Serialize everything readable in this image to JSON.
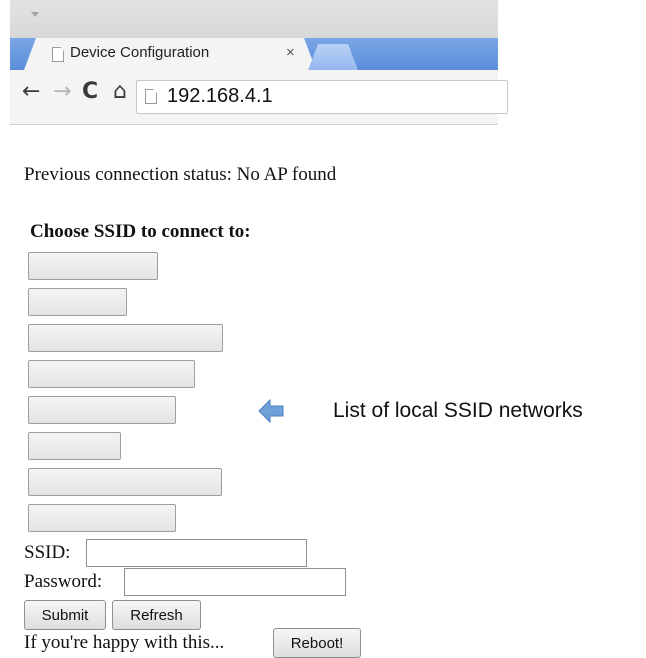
{
  "browser": {
    "tab_title": "Device Configuration",
    "tab_close": "×",
    "url": "192.168.4.1"
  },
  "page": {
    "status_text": "Previous connection status: No AP found",
    "heading": "Choose SSID to connect to:",
    "ssid_buttons": [
      "",
      "",
      "",
      "",
      "",
      "",
      "",
      ""
    ],
    "ssid_label": "SSID:",
    "password_label": "Password:",
    "ssid_value": "",
    "password_value": "",
    "submit_label": "Submit",
    "refresh_label": "Refresh",
    "footer_text": "If you're happy with this...",
    "reboot_label": "Reboot!"
  },
  "annotation": {
    "text": "List of local SSID networks",
    "arrow_color": "#6fa0d8"
  }
}
